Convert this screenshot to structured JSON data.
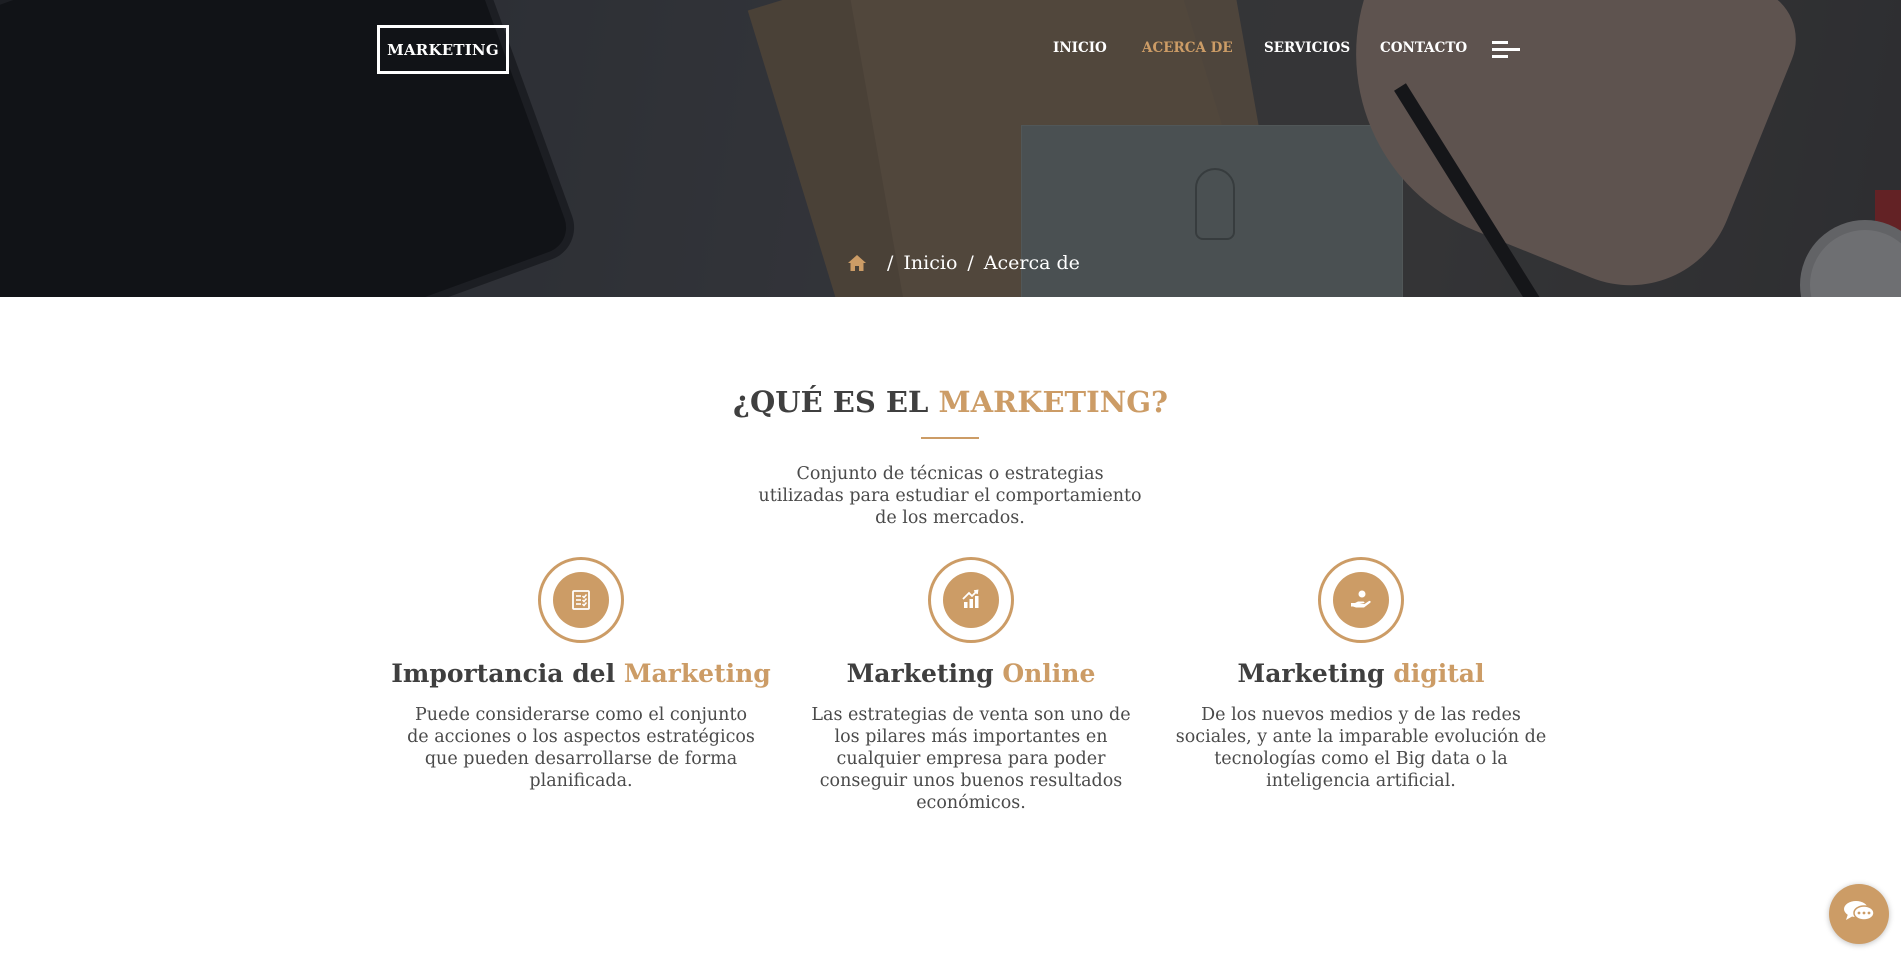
{
  "header": {
    "logo_text": "MARKETING",
    "nav": [
      {
        "label": "INICIO",
        "active": false
      },
      {
        "label": "ACERCA DE",
        "active": true
      },
      {
        "label": "SERVICIOS",
        "active": false
      },
      {
        "label": "CONTACTO",
        "active": false
      }
    ],
    "menu_icon": "hamburger-menu-icon"
  },
  "breadcrumb": {
    "home_icon": "home-icon",
    "items": [
      "Inicio",
      "Acerca de"
    ],
    "separator": "/"
  },
  "about": {
    "title_prefix": "¿QUÉ ES EL",
    "title_accent": "MARKETING?",
    "intro": "Conjunto de técnicas o estrategias utilizadas para estudiar el comportamiento de los mercados."
  },
  "features": [
    {
      "icon": "checklist-document-icon",
      "title_prefix": "Importancia del",
      "title_accent": "Marketing",
      "text": "Puede considerarse como el conjunto de acciones o los aspectos estratégicos que pueden desarrollarse de forma planificada."
    },
    {
      "icon": "growth-chart-icon",
      "title_prefix": "Marketing",
      "title_accent": "Online",
      "text": "Las estrategias de venta son uno de los pilares más importantes en cualquier empresa para poder conseguir unos buenos resultados económicos."
    },
    {
      "icon": "hand-coin-icon",
      "title_prefix": "Marketing",
      "title_accent": "digital",
      "text": "De los nuevos medios y de las redes sociales, y ante la imparable evolución de tecnologías como el Big data o la inteligencia artificial."
    }
  ],
  "chat_widget": {
    "icon": "chat-bubbles-icon"
  },
  "colors": {
    "accent": "#cc9c66",
    "heading": "#3f3f3f",
    "body_text": "#4a4a4a",
    "nav_text": "#ffffff"
  }
}
